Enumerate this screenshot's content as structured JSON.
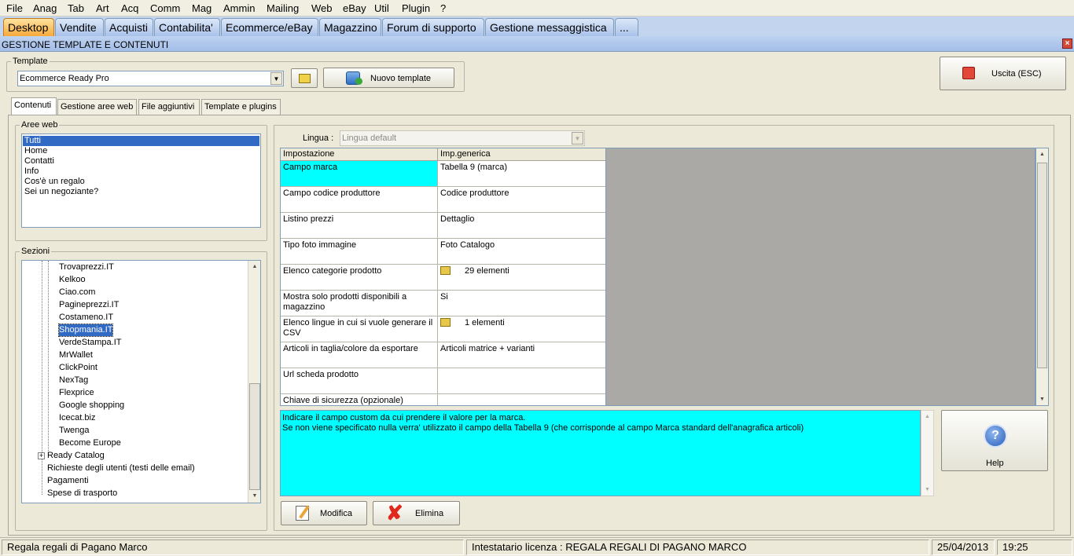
{
  "menu": [
    "File",
    "Anag",
    "Tab",
    "Art",
    "Acq",
    "Comm",
    "Mag",
    "Ammin",
    "Mailing",
    "Web",
    "eBay",
    "Util",
    "Plugin",
    "?"
  ],
  "main_tabs": [
    "Desktop",
    "Vendite",
    "Acquisti",
    "Contabilita'",
    "Ecommerce/eBay",
    "Magazzino",
    "Forum di supporto",
    "Gestione messaggistica",
    "..."
  ],
  "window": {
    "title": "GESTIONE TEMPLATE E CONTENUTI",
    "close": "×"
  },
  "template": {
    "legend": "Template",
    "selected": "Ecommerce Ready Pro",
    "new_button": "Nuovo template"
  },
  "exit_button": "Uscita (ESC)",
  "sub_tabs": [
    "Contenuti",
    "Gestione aree web",
    "File aggiuntivi",
    "Template e plugins"
  ],
  "aree_web": {
    "legend": "Aree web",
    "items": [
      "Tutti",
      "Home",
      "Contatti",
      "Info",
      "Cos'è un regalo",
      "Sei un negoziante?"
    ]
  },
  "sezioni": {
    "legend": "Sezioni",
    "children": [
      "Trovaprezzi.IT",
      "Kelkoo",
      "Ciao.com",
      "Pagineprezzi.IT",
      "Costameno.IT",
      "Shopmania.IT",
      "VerdeStampa.IT",
      "MrWallet",
      "ClickPoint",
      "NexTag",
      "Flexprice",
      "Google shopping",
      "Icecat.biz",
      "Twenga",
      "Become Europe"
    ],
    "roots": [
      "Ready Catalog",
      "Richieste degli utenti (testi delle email)",
      "Pagamenti",
      "Spese di trasporto"
    ],
    "expander": "+"
  },
  "lingua": {
    "label": "Lingua :",
    "value": "Lingua default"
  },
  "grid": {
    "headers": [
      "Impostazione",
      "Imp.generica"
    ],
    "rows": [
      {
        "setting": "Campo marca",
        "value": "Tabella 9 (marca)"
      },
      {
        "setting": "Campo codice produttore",
        "value": "Codice produttore"
      },
      {
        "setting": "Listino prezzi",
        "value": "Dettaglio"
      },
      {
        "setting": "Tipo foto immagine",
        "value": "Foto Catalogo"
      },
      {
        "setting": "Elenco categorie prodotto",
        "value": "29 elementi"
      },
      {
        "setting": "Mostra solo prodotti disponibili a magazzino",
        "value": "Si"
      },
      {
        "setting": "Elenco lingue in cui si vuole generare il CSV",
        "value": "1 elementi"
      },
      {
        "setting": "Articoli in taglia/colore da esportare",
        "value": "Articoli matrice + varianti"
      },
      {
        "setting": "Url scheda prodotto",
        "value": ""
      },
      {
        "setting": "Chiave di sicurezza (opzionale)",
        "value": ""
      }
    ]
  },
  "description": {
    "line1": "Indicare il campo custom da cui prendere il valore per la marca.",
    "line2": "Se non viene specificato nulla verra' utilizzato il campo della Tabella 9 (che corrisponde al campo Marca standard dell'anagrafica articoli)"
  },
  "help_button": "Help",
  "modifica_button": "Modifica",
  "elimina_button": "Elimina",
  "status": {
    "company": "Regala regali di Pagano Marco",
    "license": "Intestatario licenza : REGALA REGALI DI PAGANO MARCO",
    "date": "25/04/2013",
    "time": "19:25"
  },
  "colors": {
    "highlight": "#00ffff",
    "active_tab": "#f8a93a",
    "selection": "#316ac5"
  }
}
